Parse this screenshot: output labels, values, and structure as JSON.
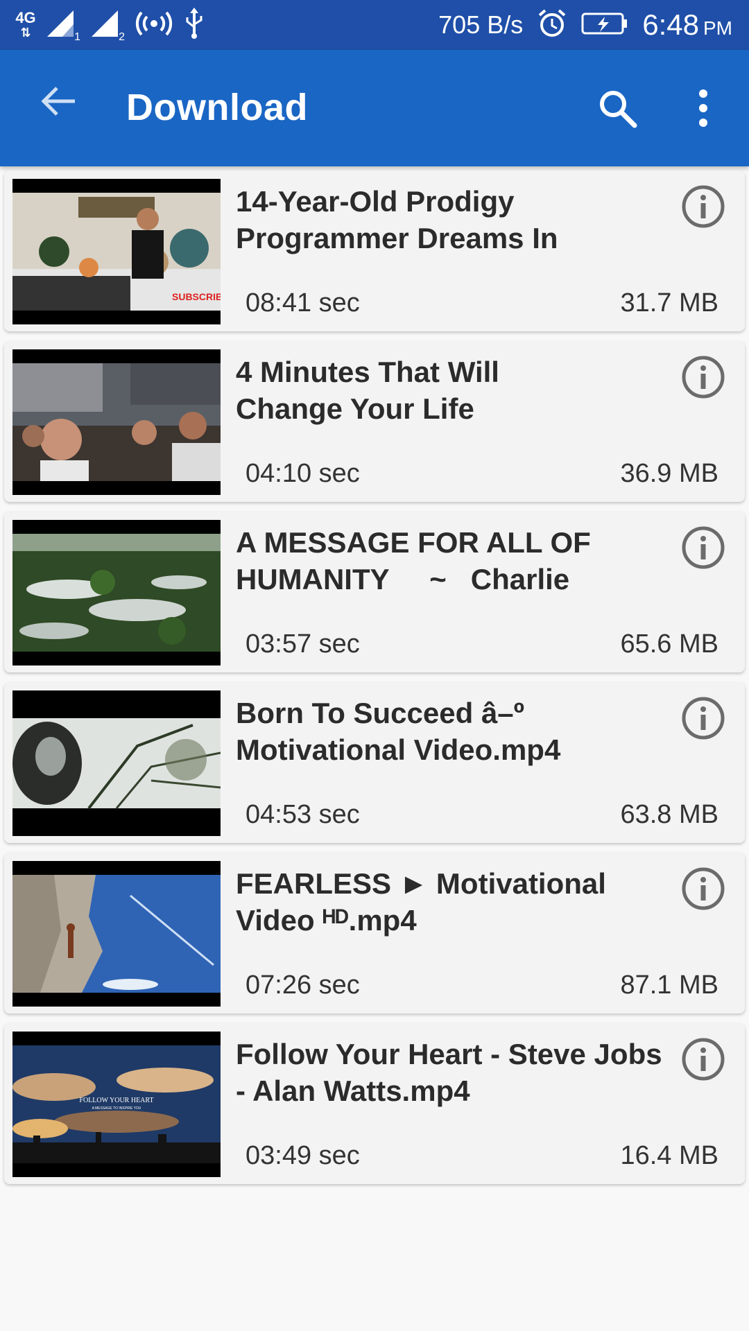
{
  "status_bar": {
    "network_type": "4G",
    "sim1_label": "1",
    "sim2_label": "2",
    "net_speed": "705 B/s",
    "time": "6:48",
    "time_suffix": "PM"
  },
  "app_bar": {
    "title": "Download",
    "back_icon": "arrow-left-icon",
    "search_icon": "search-icon",
    "more_icon": "more-vert-icon"
  },
  "colors": {
    "status_bar": "#1f4fa8",
    "app_bar": "#1a66c4",
    "card_bg": "#f4f3f3",
    "page_bg": "#f9f8f8"
  },
  "videos": [
    {
      "title": "14-Year-Old Prodigy\nProgrammer Dreams In",
      "duration": "08:41 sec",
      "size": "31.7 MB",
      "thumb_icon": "video-thumbnail-icon"
    },
    {
      "title": "4 Minutes That Will\nChange Your Life",
      "duration": "04:10 sec",
      "size": "36.9 MB",
      "thumb_icon": "video-thumbnail-icon"
    },
    {
      "title": "A MESSAGE FOR ALL OF\nHUMANITY     ~   Charlie",
      "duration": "03:57 sec",
      "size": "65.6 MB",
      "thumb_icon": "video-thumbnail-icon"
    },
    {
      "title": "Born To Succeed â–º\nMotivational Video.mp4",
      "duration": "04:53 sec",
      "size": "63.8 MB",
      "thumb_icon": "video-thumbnail-icon"
    },
    {
      "title": "FEARLESS ► Motivational\nVideo ᴴᴰ.mp4",
      "duration": "07:26 sec",
      "size": "87.1 MB",
      "thumb_icon": "video-thumbnail-icon"
    },
    {
      "title": "Follow Your Heart - Steve Jobs\n- Alan Watts.mp4",
      "duration": "03:49 sec",
      "size": "16.4 MB",
      "thumb_icon": "video-thumbnail-icon",
      "thumb_caption": "FOLLOW YOUR HEART",
      "thumb_subcaption": "A MESSAGE TO INSPIRE YOU"
    }
  ]
}
